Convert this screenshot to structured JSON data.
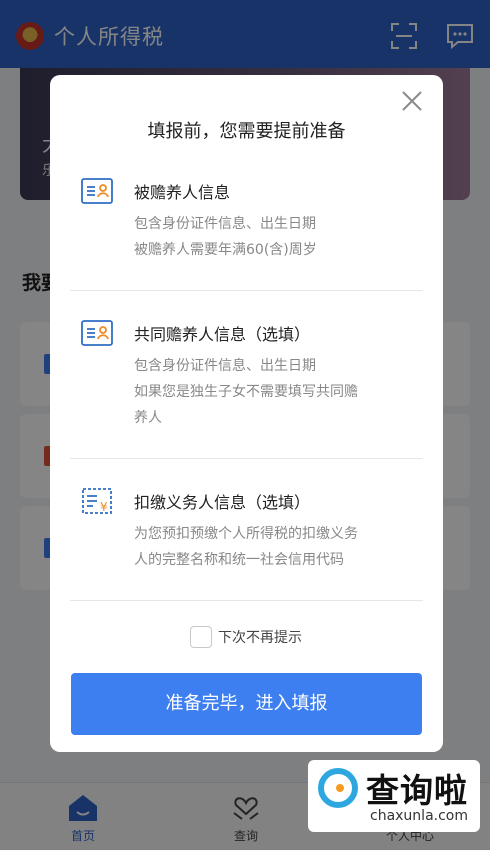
{
  "app": {
    "title": "个人所得税"
  },
  "banner": {
    "line1": "大",
    "line2": "乐"
  },
  "section": {
    "heading": "我要"
  },
  "tabs": [
    {
      "label": "首页",
      "icon": "home-icon",
      "active": true
    },
    {
      "label": "查询",
      "icon": "heart-hands-icon",
      "active": false
    },
    {
      "label": "个人中心",
      "icon": "person-icon",
      "active": false
    }
  ],
  "dialog": {
    "title": "填报前，您需要提前准备",
    "items": [
      {
        "icon": "id-card-icon",
        "title": "被赡养人信息",
        "desc_line1": "包含身份证件信息、出生日期",
        "desc_line2": "被赡养人需要年满60(含)周岁"
      },
      {
        "icon": "id-card-icon",
        "title": "共同赡养人信息（选填）",
        "desc_line1": "包含身份证件信息、出生日期",
        "desc_line2": "如果您是独生子女不需要填写共同赡",
        "desc_line3": "养人"
      },
      {
        "icon": "tax-document-icon",
        "title": "扣缴义务人信息（选填）",
        "desc_line1": "为您预扣预缴个人所得税的扣缴义务",
        "desc_line2": "人的完整名称和统一社会信用代码"
      }
    ],
    "checkbox_label": "下次不再提示",
    "checkbox_checked": false,
    "confirm_label": "准备完毕，进入填报"
  },
  "watermark": {
    "text": "查询啦",
    "url": "chaxunla.com"
  },
  "colors": {
    "brand_blue": "#2d63c8",
    "button_blue": "#3d7ff0",
    "icon_blue": "#2f6fc4",
    "icon_orange": "#f08a24"
  }
}
